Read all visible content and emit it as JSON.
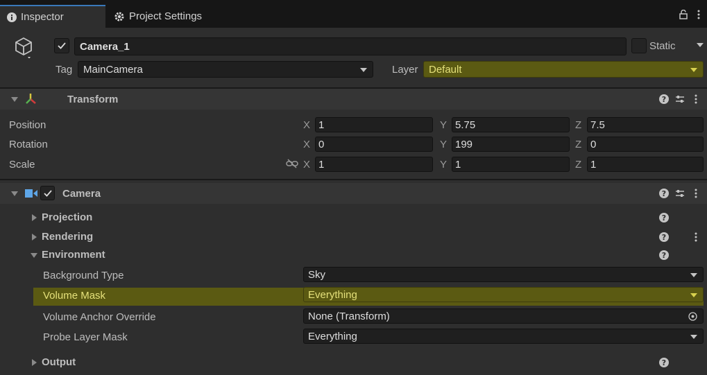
{
  "tabs": {
    "inspector": "Inspector",
    "project_settings": "Project Settings"
  },
  "gameobject": {
    "name": "Camera_1",
    "static_label": "Static",
    "tag_label": "Tag",
    "tag_value": "MainCamera",
    "layer_label": "Layer",
    "layer_value": "Default"
  },
  "transform": {
    "title": "Transform",
    "rows": [
      {
        "label": "Position",
        "x": "1",
        "y": "5.75",
        "z": "7.5"
      },
      {
        "label": "Rotation",
        "x": "0",
        "y": "199",
        "z": "0"
      },
      {
        "label": "Scale",
        "x": "1",
        "y": "1",
        "z": "1"
      }
    ],
    "axis_x": "X",
    "axis_y": "Y",
    "axis_z": "Z"
  },
  "camera": {
    "title": "Camera",
    "sections": {
      "projection": "Projection",
      "rendering": "Rendering",
      "environment": "Environment",
      "output": "Output"
    },
    "environment": {
      "background_type_label": "Background Type",
      "background_type_value": "Sky",
      "volume_mask_label": "Volume Mask",
      "volume_mask_value": "Everything",
      "volume_anchor_label": "Volume Anchor Override",
      "volume_anchor_value": "None (Transform)",
      "probe_layer_label": "Probe Layer Mask",
      "probe_layer_value": "Everything"
    }
  },
  "colors": {
    "accent": "#3a79bb",
    "highlight": "#5b5a12",
    "panel": "#2e2e2e"
  }
}
